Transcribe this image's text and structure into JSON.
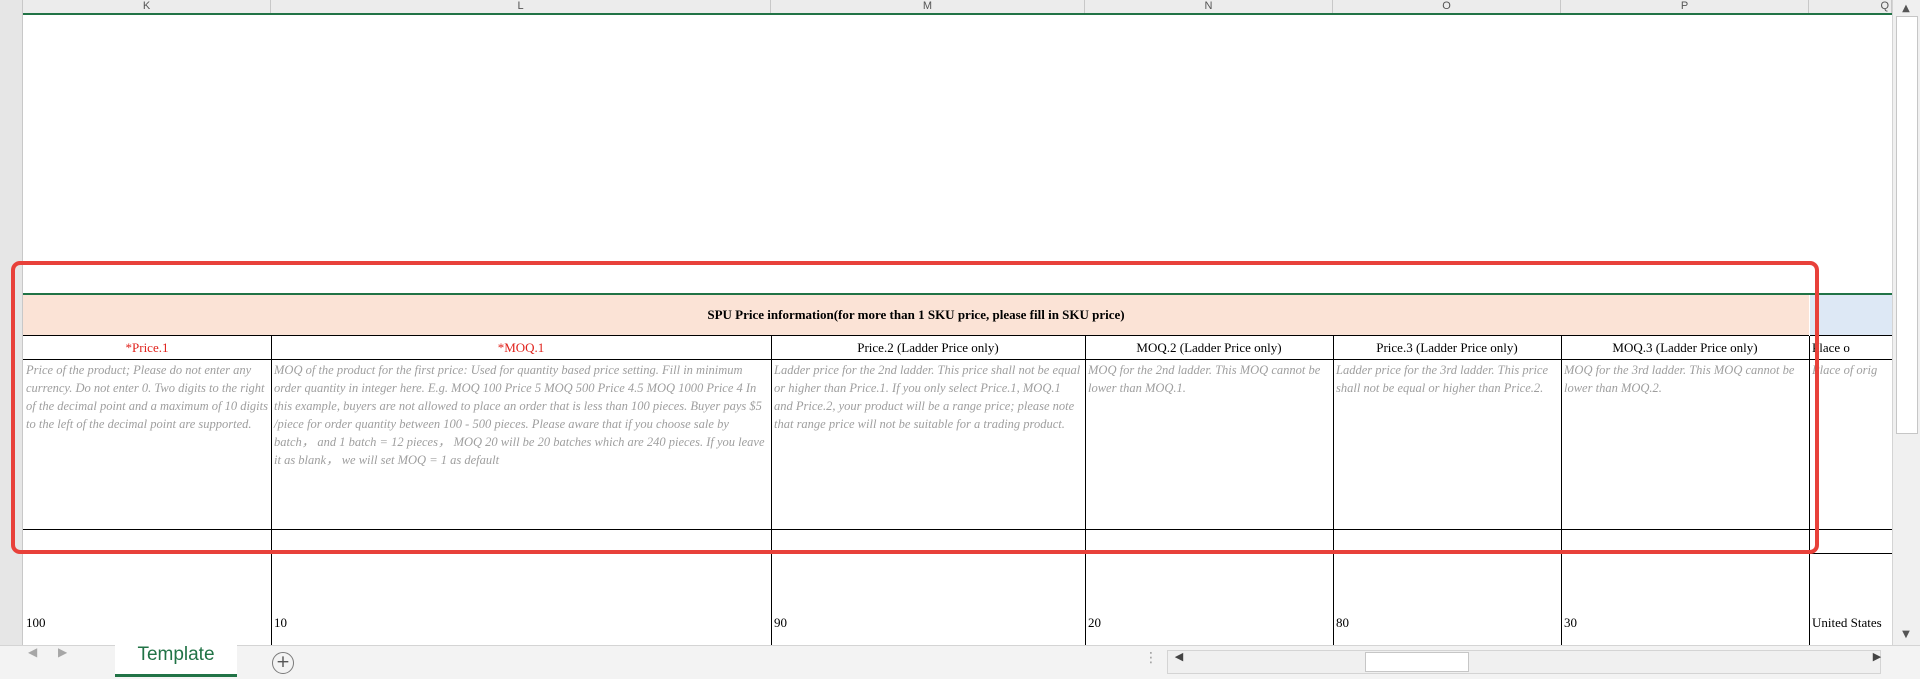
{
  "columns": [
    {
      "letter": "K"
    },
    {
      "letter": "L"
    },
    {
      "letter": "M"
    },
    {
      "letter": "N"
    },
    {
      "letter": "O"
    },
    {
      "letter": "P"
    },
    {
      "letter": "Q"
    }
  ],
  "section_title": "SPU Price information(for more than 1 SKU price, please fill in SKU price)",
  "fields": [
    {
      "label": "*Price.1",
      "required": true,
      "description": "Price of the product; Please do not enter any currency. Do not enter 0. Two digits to the right of the decimal point and a maximum of 10 digits to the left of the decimal point are supported.",
      "value": "100"
    },
    {
      "label": "*MOQ.1",
      "required": true,
      "description": "MOQ of the product for the first price: Used for quantity based price setting. Fill in minimum order quantity in integer here. E.g. MOQ 100 Price 5 MOQ 500 Price 4.5 MOQ 1000 Price 4 In this example, buyers are not allowed to place an order that is less than 100 pieces. Buyer pays $5 /piece for order quantity between 100 - 500 pieces. Please aware that if you choose sale by batch， and 1 batch = 12 pieces， MOQ 20 will be 20 batches which are 240 pieces. If you leave it as blank， we will set MOQ = 1 as default",
      "value": "10"
    },
    {
      "label": "Price.2 (Ladder Price only)",
      "required": false,
      "description": "Ladder price for the 2nd ladder. This price shall not be equal or higher than Price.1. If you only select Price.1, MOQ.1 and Price.2, your product will be a range price; please note that range price will not be suitable for a trading product.",
      "value": "90"
    },
    {
      "label": "MOQ.2 (Ladder Price only)",
      "required": false,
      "description": "MOQ for the 2nd ladder. This MOQ cannot be lower than MOQ.1.",
      "value": "20"
    },
    {
      "label": "Price.3 (Ladder Price only)",
      "required": false,
      "description": "Ladder price for the 3rd ladder. This price shall not be equal or higher than Price.2.",
      "value": "80"
    },
    {
      "label": "MOQ.3 (Ladder Price only)",
      "required": false,
      "description": "MOQ for the 3rd ladder. This MOQ cannot be lower than MOQ.2.",
      "value": "30"
    },
    {
      "label": "Place o",
      "required": false,
      "description": "Place of orig",
      "value": "United States"
    }
  ],
  "sheet_tab": "Template",
  "colors": {
    "accent_green": "#217346",
    "required_red": "#e0211b",
    "highlight_red": "#e8413a",
    "band_peach": "#fbe3d6"
  }
}
